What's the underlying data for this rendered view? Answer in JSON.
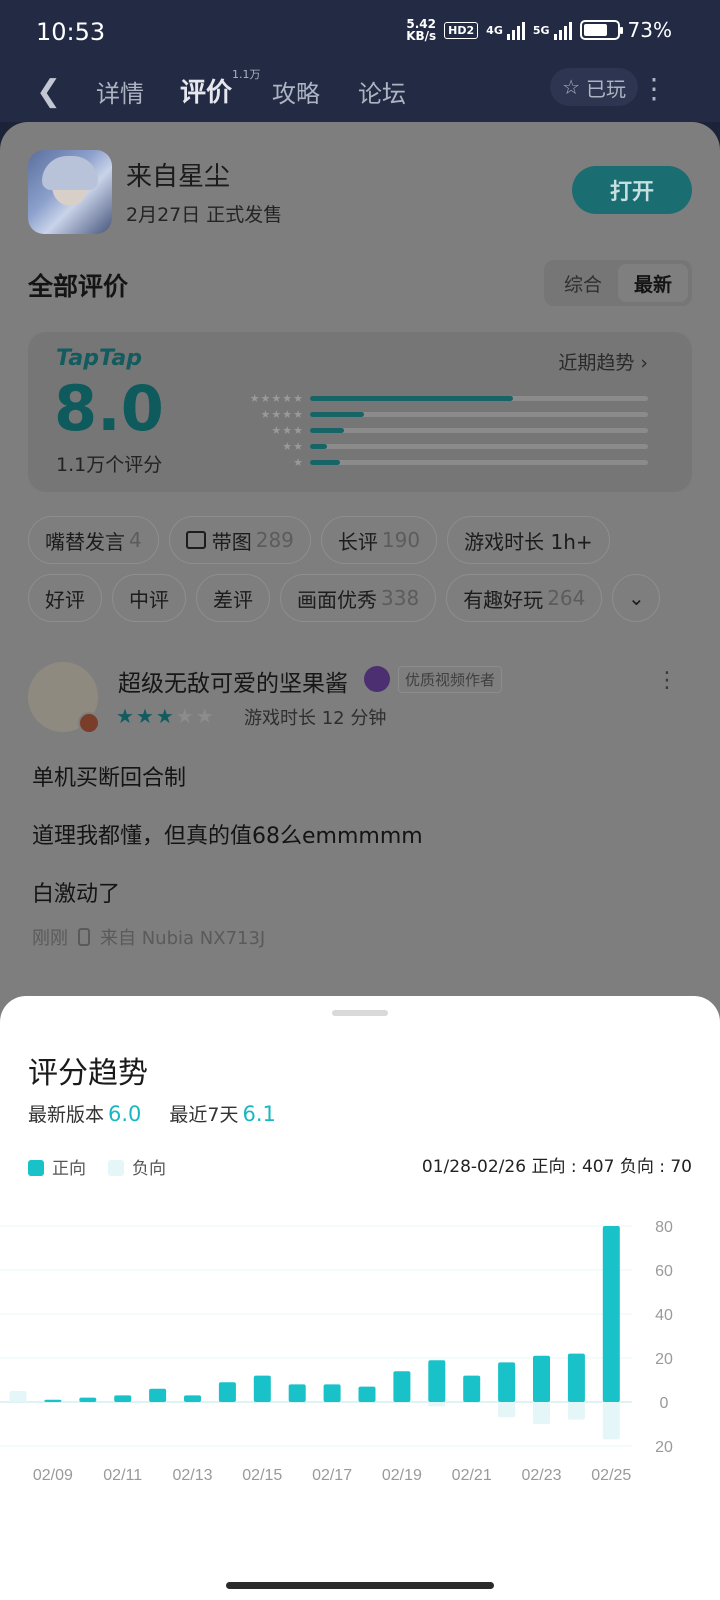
{
  "status_bar": {
    "time": "10:53",
    "speed_value": "5.42",
    "speed_unit": "KB/s",
    "hd_badge": "HD2",
    "net1": "4G",
    "net2": "5G",
    "battery_percent": "73%",
    "battery_level": 0.73
  },
  "top_nav": {
    "back_icon": "chevron-left-icon",
    "tabs": [
      {
        "label": "详情",
        "active": false
      },
      {
        "label": "评价",
        "active": true,
        "badge": "1.1万"
      },
      {
        "label": "攻略",
        "active": false
      },
      {
        "label": "论坛",
        "active": false
      }
    ],
    "played_label": "已玩",
    "played_icon": "star-outline-icon",
    "more_icon": "more-vertical-icon"
  },
  "app": {
    "name": "来自星尘",
    "release": "2月27日 正式发售",
    "open_label": "打开"
  },
  "reviews": {
    "title": "全部评价",
    "sort_options": [
      "综合",
      "最新"
    ],
    "sort_selected": "最新"
  },
  "rating": {
    "brand": "TapTap",
    "score": "8.0",
    "count": "1.1万个评分",
    "trend_link": "近期趋势",
    "distribution": [
      {
        "stars": 5,
        "fraction": 0.6
      },
      {
        "stars": 4,
        "fraction": 0.16
      },
      {
        "stars": 3,
        "fraction": 0.1
      },
      {
        "stars": 2,
        "fraction": 0.05
      },
      {
        "stars": 1,
        "fraction": 0.09
      }
    ]
  },
  "filters": {
    "row1": [
      {
        "label": "嘴替发言",
        "count": "4"
      },
      {
        "label": "带图",
        "count": "289",
        "icon": "image-icon"
      },
      {
        "label": "长评",
        "count": "190"
      },
      {
        "label": "游戏时长 1h+",
        "count": ""
      }
    ],
    "row2": [
      {
        "label": "好评",
        "count": ""
      },
      {
        "label": "中评",
        "count": ""
      },
      {
        "label": "差评",
        "count": ""
      },
      {
        "label": "画面优秀",
        "count": "338"
      },
      {
        "label": "有趣好玩",
        "count": "264"
      }
    ],
    "expand_icon": "chevron-down-icon"
  },
  "review": {
    "author": "超级无敌可爱的坚果酱",
    "tag": "优质视频作者",
    "stars_filled": 3,
    "stars_total": 5,
    "playtime": "游戏时长 12 分钟",
    "lines": [
      "单机买断回合制",
      "道理我都懂，但真的值68么emmmmm",
      "白激动了"
    ],
    "time": "刚刚",
    "device": "来自 Nubia NX713J"
  },
  "sheet": {
    "title": "评分趋势",
    "latest_version_label": "最新版本",
    "latest_version_value": "6.0",
    "recent_label": "最近7天",
    "recent_value": "6.1",
    "legend_positive": "正向",
    "legend_negative": "负向",
    "positive_color": "#18c2c8",
    "negative_color": "#e4f6f7",
    "summary": "01/28-02/26  正向 : 407   负向 : 70"
  },
  "chart_data": {
    "type": "bar",
    "categories": [
      "02/08",
      "02/09",
      "02/10",
      "02/11",
      "02/12",
      "02/13",
      "02/14",
      "02/15",
      "02/16",
      "02/17",
      "02/18",
      "02/19",
      "02/20",
      "02/21",
      "02/22",
      "02/23",
      "02/24",
      "02/25",
      "02/26"
    ],
    "tick_labels": [
      "02/09",
      "02/11",
      "02/13",
      "02/15",
      "02/17",
      "02/19",
      "02/21",
      "02/23",
      "02/25"
    ],
    "series": [
      {
        "name": "正向",
        "values": [
          5,
          1,
          2,
          3,
          6,
          3,
          9,
          12,
          8,
          8,
          7,
          14,
          19,
          12,
          18,
          21,
          22,
          80,
          0
        ]
      },
      {
        "name": "负向",
        "values": [
          0,
          0,
          0,
          0,
          0,
          0,
          0,
          0,
          0,
          0,
          0,
          0,
          -2,
          0,
          -7,
          -10,
          -8,
          -17,
          0
        ]
      }
    ],
    "y_tick_labels": [
      "80",
      "60",
      "40",
      "20",
      "0",
      "20"
    ],
    "ylim": [
      -20,
      80
    ],
    "grid": true
  }
}
